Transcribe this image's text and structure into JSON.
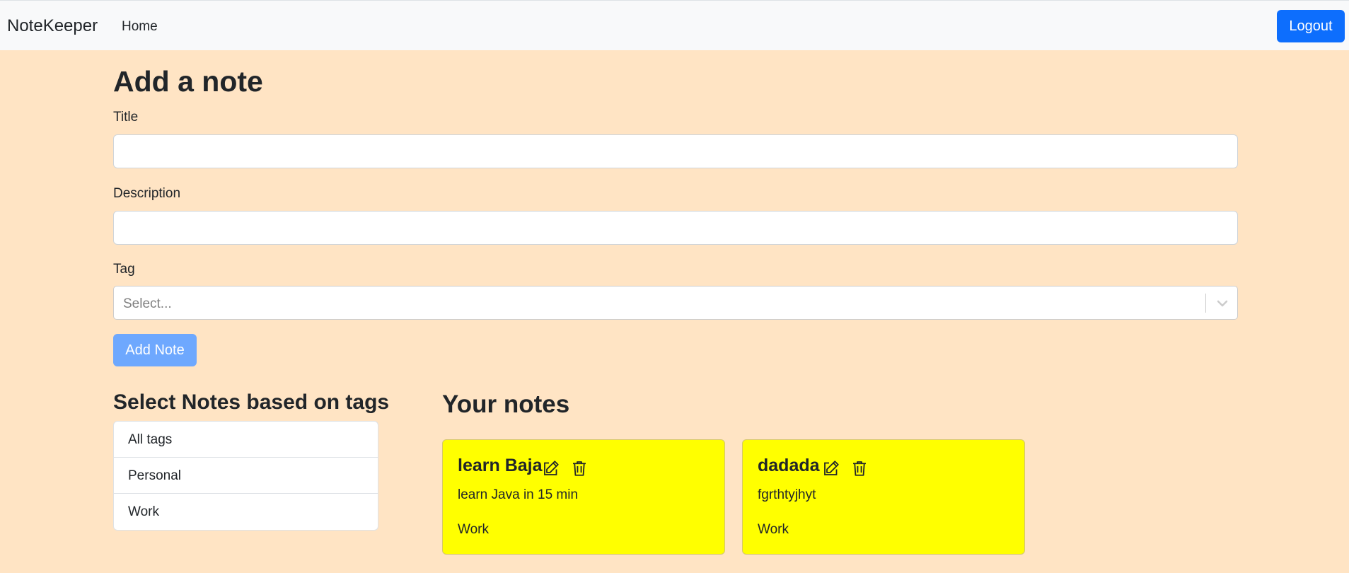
{
  "navbar": {
    "brand": "NoteKeeper",
    "home": "Home",
    "logout": "Logout"
  },
  "form": {
    "heading": "Add a note",
    "title_label": "Title",
    "title_value": "",
    "description_label": "Description",
    "description_value": "",
    "tag_label": "Tag",
    "tag_placeholder": "Select...",
    "submit": "Add Note"
  },
  "tags": {
    "heading": "Select Notes based on tags",
    "items": [
      "All tags",
      "Personal",
      "Work"
    ]
  },
  "notes": {
    "heading": "Your notes",
    "items": [
      {
        "title": "learn Baja",
        "description": "learn Java in 15 min",
        "tag": "Work"
      },
      {
        "title": "dadada",
        "description": "fgrthtyjhyt",
        "tag": "Work"
      }
    ]
  },
  "colors": {
    "page_background": "#ffe4c4",
    "note_background": "#ffff00",
    "primary": "#0d6efd"
  },
  "icons": {
    "edit": "edit-icon",
    "delete": "trash-icon",
    "dropdown": "chevron-down-icon"
  }
}
